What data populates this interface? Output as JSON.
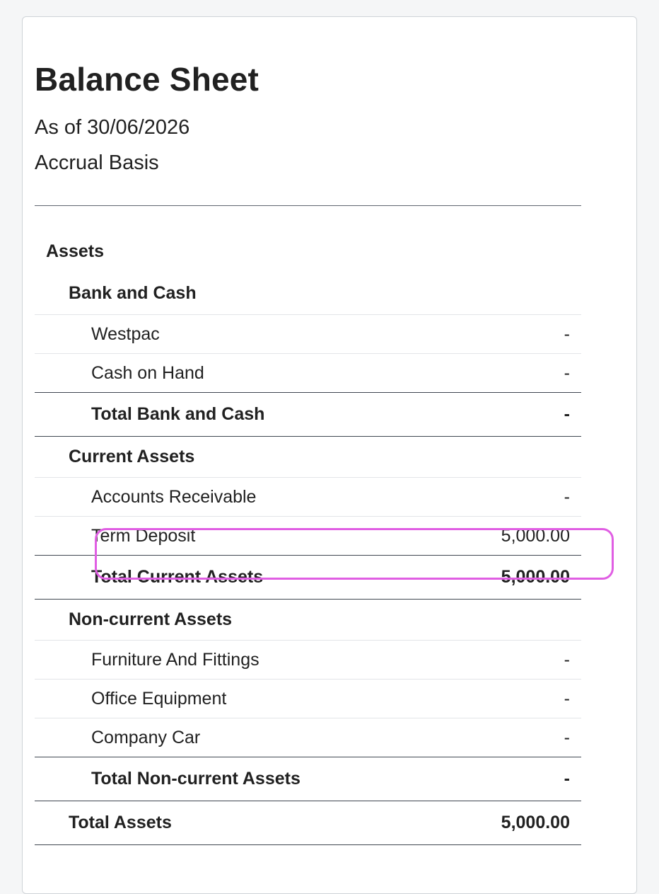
{
  "report": {
    "title": "Balance Sheet",
    "as_of": "As of 30/06/2026",
    "basis": "Accrual Basis"
  },
  "assets": {
    "heading": "Assets",
    "bank_and_cash": {
      "heading": "Bank and Cash",
      "items": [
        {
          "label": "Westpac",
          "amount": "-"
        },
        {
          "label": "Cash on Hand",
          "amount": "-"
        }
      ],
      "total_label": "Total Bank and Cash",
      "total_amount": "-"
    },
    "current_assets": {
      "heading": "Current Assets",
      "items": [
        {
          "label": "Accounts Receivable",
          "amount": "-"
        },
        {
          "label": "Term Deposit",
          "amount": "5,000.00"
        }
      ],
      "total_label": "Total Current Assets",
      "total_amount": "5,000.00"
    },
    "non_current_assets": {
      "heading": "Non-current Assets",
      "items": [
        {
          "label": "Furniture And Fittings",
          "amount": "-"
        },
        {
          "label": "Office Equipment",
          "amount": "-"
        },
        {
          "label": "Company Car",
          "amount": "-"
        }
      ],
      "total_label": "Total Non-current Assets",
      "total_amount": "-"
    },
    "total_label": "Total Assets",
    "total_amount": "5,000.00"
  },
  "highlight": {
    "color": "#e05ee3",
    "target": "Term Deposit"
  }
}
